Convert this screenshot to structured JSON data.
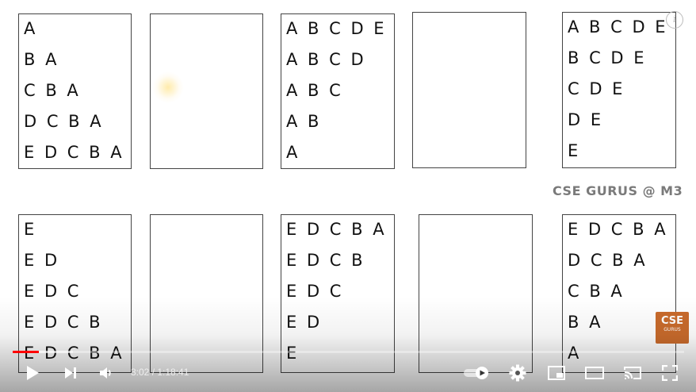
{
  "slide": {
    "boxes_top": [
      {
        "lines": [
          "A",
          "B A",
          "C B A",
          "D C B A",
          "E D C B A"
        ]
      },
      {
        "lines": []
      },
      {
        "lines": [
          "A B C D E",
          "A B C D",
          "A B C",
          "A B",
          "A"
        ]
      },
      {
        "lines": []
      },
      {
        "lines": [
          "A B C D E",
          "B C D E",
          "C D E",
          "D E",
          "E"
        ]
      }
    ],
    "boxes_bottom": [
      {
        "lines": [
          "E",
          "E D",
          "E D C",
          "E D C B",
          "E D C B A"
        ]
      },
      {
        "lines": []
      },
      {
        "lines": [
          "E D C B A",
          "E D C B",
          "E D C",
          "E D",
          "E"
        ]
      },
      {
        "lines": []
      },
      {
        "lines": [
          "E D C B A",
          "D C B A",
          "C B A",
          "B A",
          "A"
        ]
      }
    ],
    "watermark": "CSE GURUS @ M3"
  },
  "overlay": {
    "info_glyph": "i",
    "channel_logo_text": "CSE",
    "channel_logo_sub": "GURUS"
  },
  "player": {
    "time_display": "3:02 / 1:18:41",
    "progress_played_fraction": 0.039,
    "progress_loaded_fraction": 0.09,
    "colors": {
      "progress": "#ff0000",
      "controls": "#ffffff"
    },
    "icons": [
      "play-icon",
      "next-icon",
      "volume-icon",
      "autoplay-toggle-icon",
      "settings-icon",
      "miniplayer-icon",
      "theater-icon",
      "cast-icon",
      "fullscreen-icon"
    ]
  }
}
